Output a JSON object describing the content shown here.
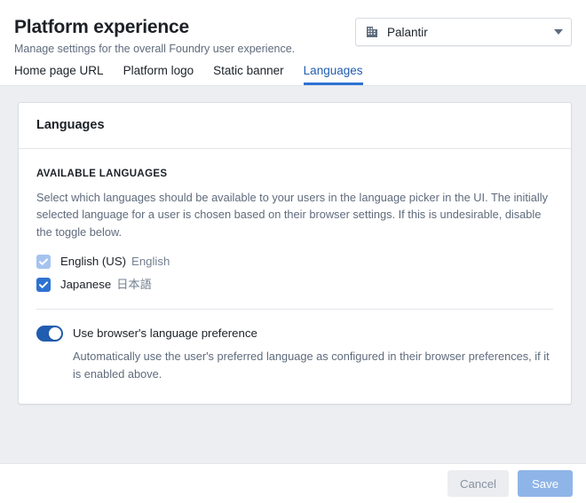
{
  "header": {
    "title": "Platform experience",
    "subtitle": "Manage settings for the overall Foundry user experience.",
    "org_selector": {
      "icon": "office-icon",
      "value": "Palantir",
      "caret_icon": "chevron-down-icon"
    }
  },
  "tabs": [
    {
      "label": "Home page URL",
      "active": false
    },
    {
      "label": "Platform logo",
      "active": false
    },
    {
      "label": "Static banner",
      "active": false
    },
    {
      "label": "Languages",
      "active": true
    }
  ],
  "card": {
    "title": "Languages",
    "section_label": "AVAILABLE LANGUAGES",
    "section_description": "Select which languages should be available to your users in the language picker in the UI. The initially selected language for a user is chosen based on their browser settings. If this is undesirable, disable the toggle below.",
    "languages": [
      {
        "label": "English (US)",
        "native": "English",
        "checked": true,
        "state": "muted"
      },
      {
        "label": "Japanese",
        "native": "日本語",
        "checked": true,
        "state": "active"
      }
    ],
    "browser_preference": {
      "label": "Use browser's language preference",
      "description": "Automatically use the user's preferred language as configured in their browser preferences, if it is enabled above.",
      "enabled": true
    }
  },
  "footer": {
    "cancel_label": "Cancel",
    "save_label": "Save",
    "cancel_disabled": true,
    "save_disabled": true
  },
  "colors": {
    "accent": "#2d72d2",
    "accent_dark": "#215db0",
    "accent_muted": "#a5c3ef",
    "text": "#1c2127",
    "text_muted": "#5f6b7c",
    "page_bg": "#eceef1",
    "card_bg": "#ffffff",
    "border": "#d9dde2",
    "save_disabled_bg": "#8fb5e8",
    "cancel_disabled_bg": "#ebedf0"
  }
}
